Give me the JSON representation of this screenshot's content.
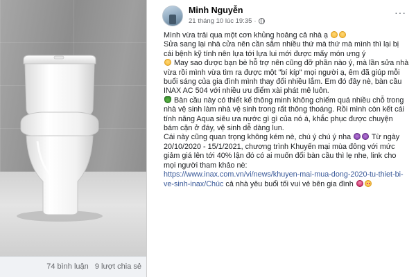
{
  "photo": {
    "comments_count": "74 bình luận",
    "shares_count": "9 lượt chia sẻ"
  },
  "post": {
    "author": "Minh Nguyễn",
    "timestamp": "21 tháng 10 lúc 19:35",
    "more_icon": "more-horizontal-icon",
    "line1": "Mình vừa trải qua một cơn khủng hoảng cả nhà ạ",
    "line2": "Sửa sang lại nhà cửa nên cần sắm nhiều thứ mà thứ mà mình thì lại bị cái bệnh kỹ tính nên lựa tới lựa lui mới được mấy món ưng ý",
    "line3": "May sao được bạn bè hỗ trợ nên cũng đỡ phần nào ý, mà lần sửa nhà vừa rồi mình vừa tìm ra được một \"bí kíp\" mọi người ạ, êm đã giúp mỗi buổi sáng của gia đình mình thay đổi nhiều lắm. Em đó đây nè, bàn cầu INAX AC 504 với nhiều ưu điểm xài phát mê luôn.",
    "line4": "Bàn cầu này có thiết kế thông minh không chiếm quá nhiều chỗ trong nhà vệ sinh làm nhà vệ sinh trong rất thông thoáng. Rồi mình còn kết cái tính năng Aqua siêu ưa nước gì gì của nó á, khắc phục được chuyện bám cặn ở đáy, vệ sinh dễ dàng lun.",
    "line5a": "Cái này cũng quan trọng không kém nè, chú ý chú ý nha",
    "line5b": "Từ ngày 20/10/2020 - 15/1/2021, chương trình Khuyến mại mùa đông với mức giảm giá lên tới 40% lận đó có ai muốn đổi bàn cầu thì lẹ nhe, link cho mọi người tham khảo nè:",
    "link": "https://www.inax.com.vn/vi/news/khuyen-mai-mua-dong-2020-tu-thiet-bi-ve-sinh-inax/Chúc",
    "line6": "cả nhà yêu buổi tối vui vẻ bên gia đình"
  },
  "colors": {
    "link": "#385898",
    "meta_text": "#65676b",
    "footer_bg": "#f0f2f5"
  }
}
